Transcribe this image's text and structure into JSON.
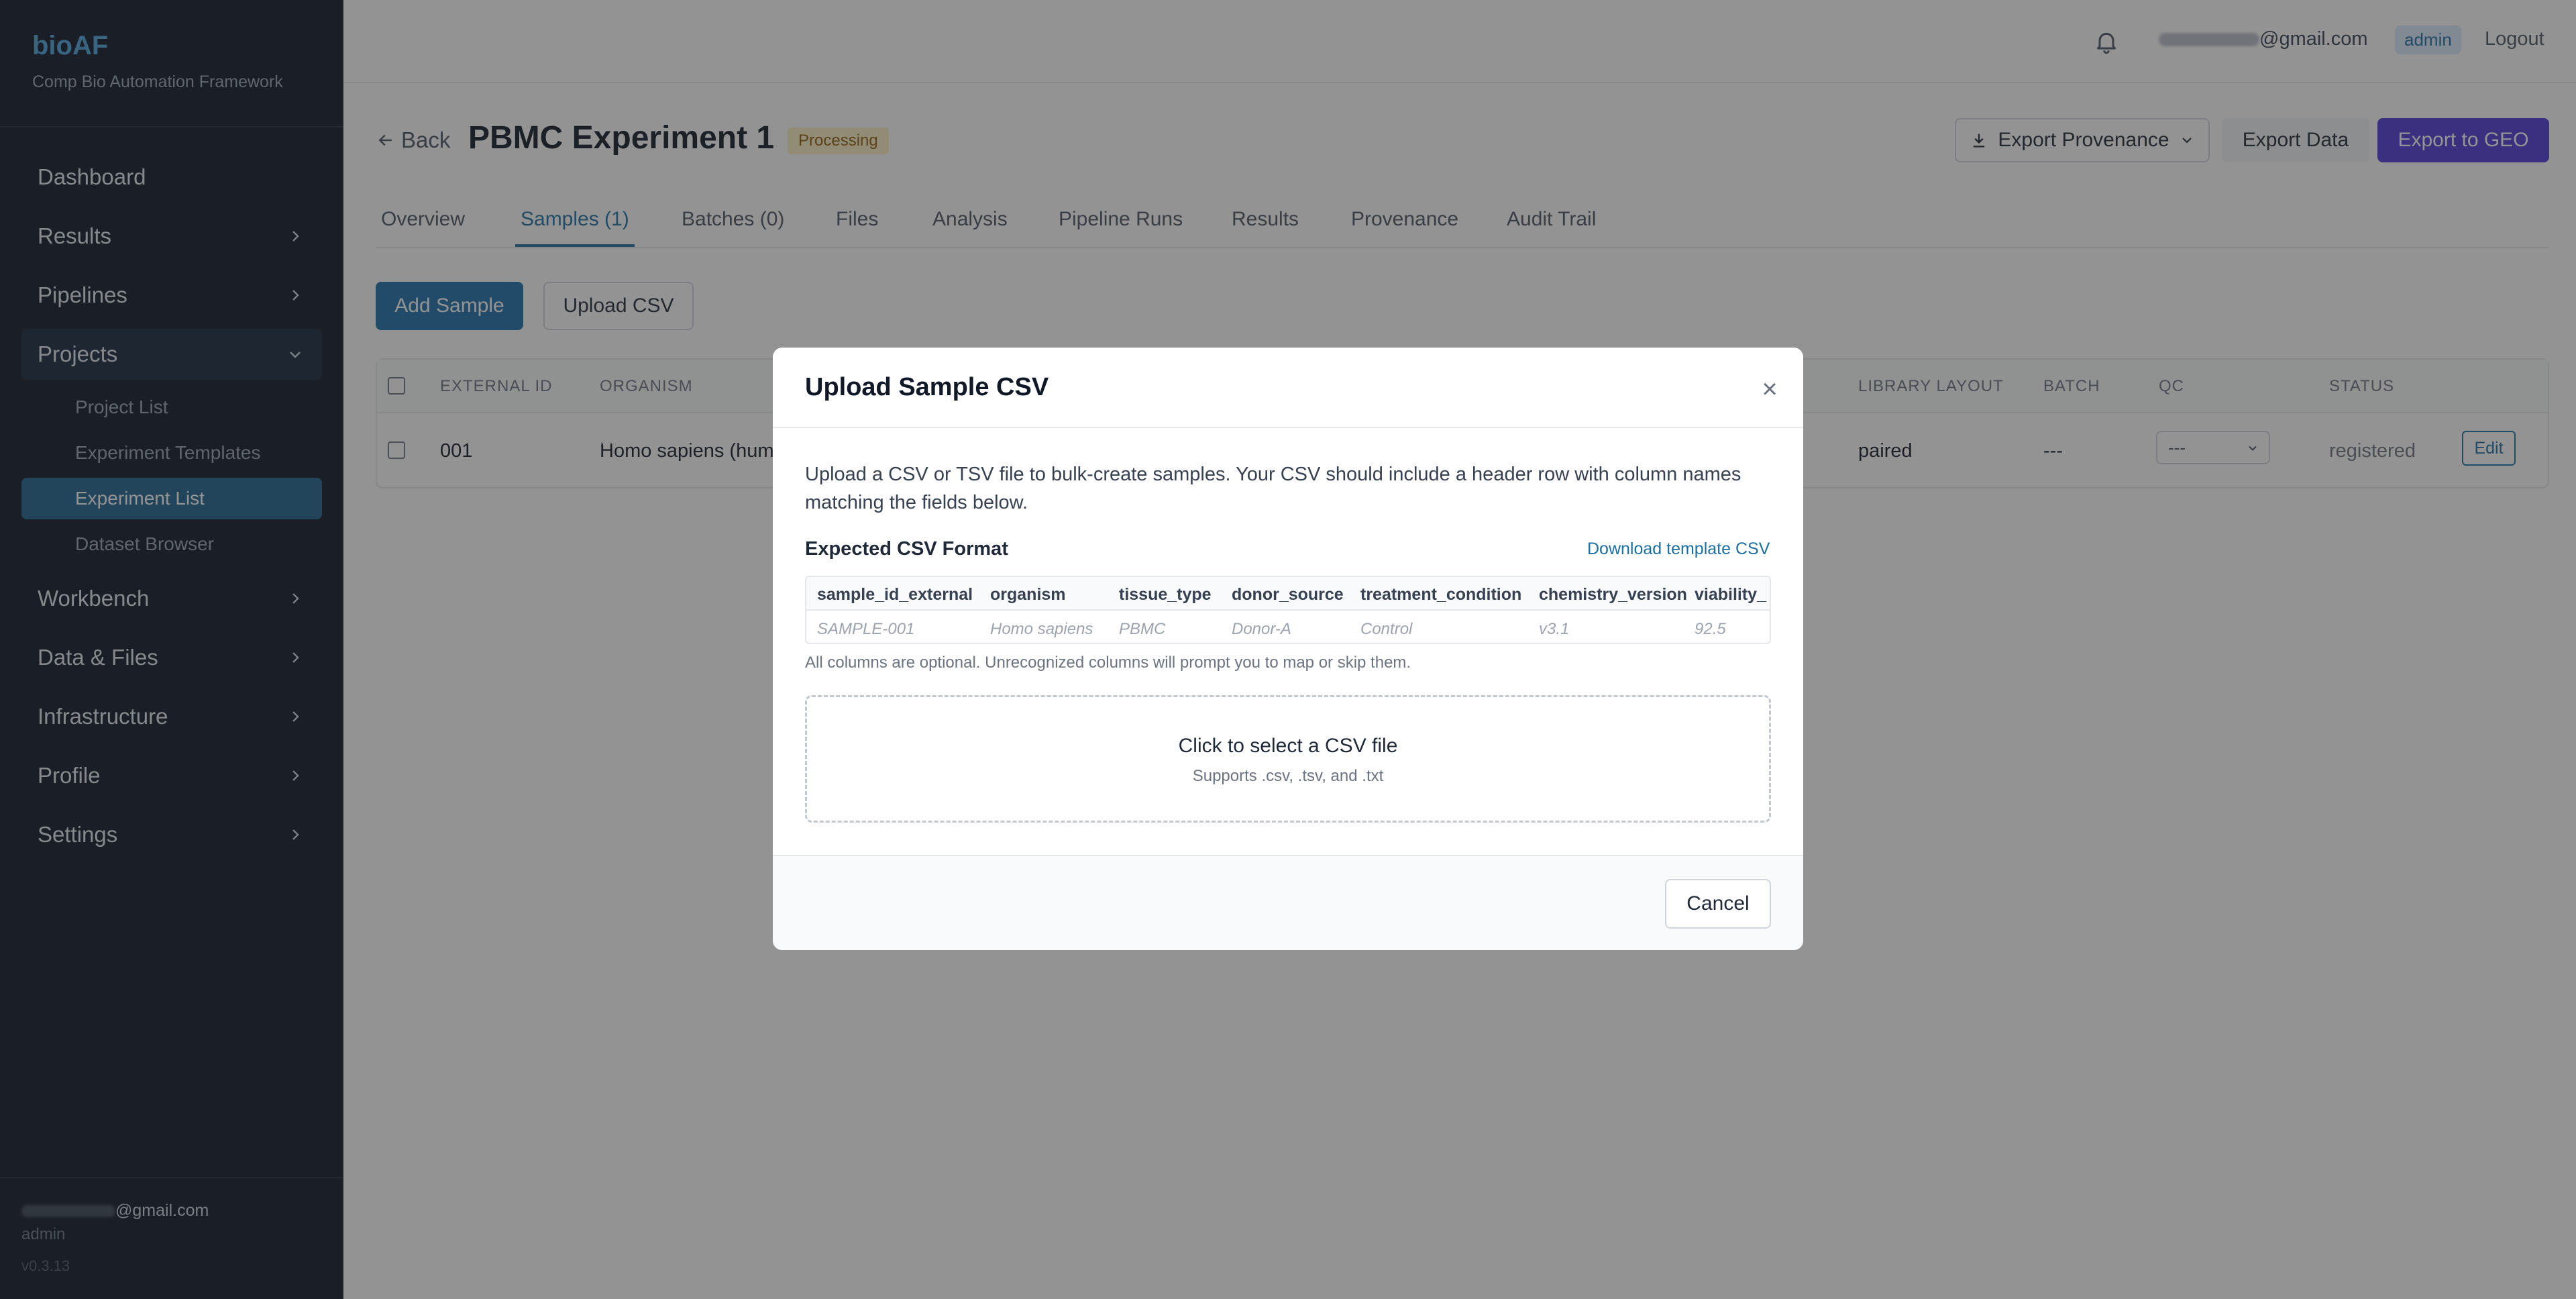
{
  "sidebar": {
    "brand": "bioAF",
    "subtitle": "Comp Bio Automation Framework",
    "nav": [
      {
        "label": "Dashboard"
      },
      {
        "label": "Results"
      },
      {
        "label": "Pipelines"
      },
      {
        "label": "Projects"
      },
      {
        "label": "Workbench"
      },
      {
        "label": "Data & Files"
      },
      {
        "label": "Infrastructure"
      },
      {
        "label": "Profile"
      },
      {
        "label": "Settings"
      }
    ],
    "project_sub": [
      {
        "label": "Project List"
      },
      {
        "label": "Experiment Templates"
      },
      {
        "label": "Experiment List"
      },
      {
        "label": "Dataset Browser"
      }
    ],
    "footer": {
      "email_suffix": "@gmail.com",
      "role": "admin",
      "version": "v0.3.13"
    }
  },
  "topbar": {
    "email_suffix": "@gmail.com",
    "role_badge": "admin",
    "logout": "Logout"
  },
  "header": {
    "back": "Back",
    "title": "PBMC Experiment 1",
    "status": "Processing",
    "export_provenance": "Export Provenance",
    "export_data": "Export Data",
    "export_geo": "Export to GEO"
  },
  "tabs": [
    {
      "label": "Overview"
    },
    {
      "label": "Samples (1)"
    },
    {
      "label": "Batches (0)"
    },
    {
      "label": "Files"
    },
    {
      "label": "Analysis"
    },
    {
      "label": "Pipeline Runs"
    },
    {
      "label": "Results"
    },
    {
      "label": "Provenance"
    },
    {
      "label": "Audit Trail"
    }
  ],
  "actions": {
    "add_sample": "Add Sample",
    "upload_csv": "Upload CSV"
  },
  "samples_table": {
    "headers": {
      "external_id": "EXTERNAL ID",
      "organism": "ORGANISM",
      "library_layout": "LIBRARY LAYOUT",
      "batch": "BATCH",
      "qc": "QC",
      "status": "STATUS"
    },
    "row": {
      "external_id": "001",
      "organism": "Homo sapiens (hum",
      "library_layout": "paired",
      "batch": "---",
      "qc": "---",
      "status": "registered",
      "edit": "Edit"
    }
  },
  "modal": {
    "title": "Upload Sample CSV",
    "description": "Upload a CSV or TSV file to bulk-create samples. Your CSV should include a header row with column names matching the fields below.",
    "format_title": "Expected CSV Format",
    "download_link": "Download template CSV",
    "columns": [
      "sample_id_external",
      "organism",
      "tissue_type",
      "donor_source",
      "treatment_condition",
      "chemistry_version",
      "viability_"
    ],
    "example": [
      "SAMPLE-001",
      "Homo sapiens",
      "PBMC",
      "Donor-A",
      "Control",
      "v3.1",
      "92.5"
    ],
    "note": "All columns are optional. Unrecognized columns will prompt you to map or skip them.",
    "dropzone_main": "Click to select a CSV file",
    "dropzone_sub": "Supports .csv, .tsv, and .txt",
    "cancel": "Cancel"
  }
}
